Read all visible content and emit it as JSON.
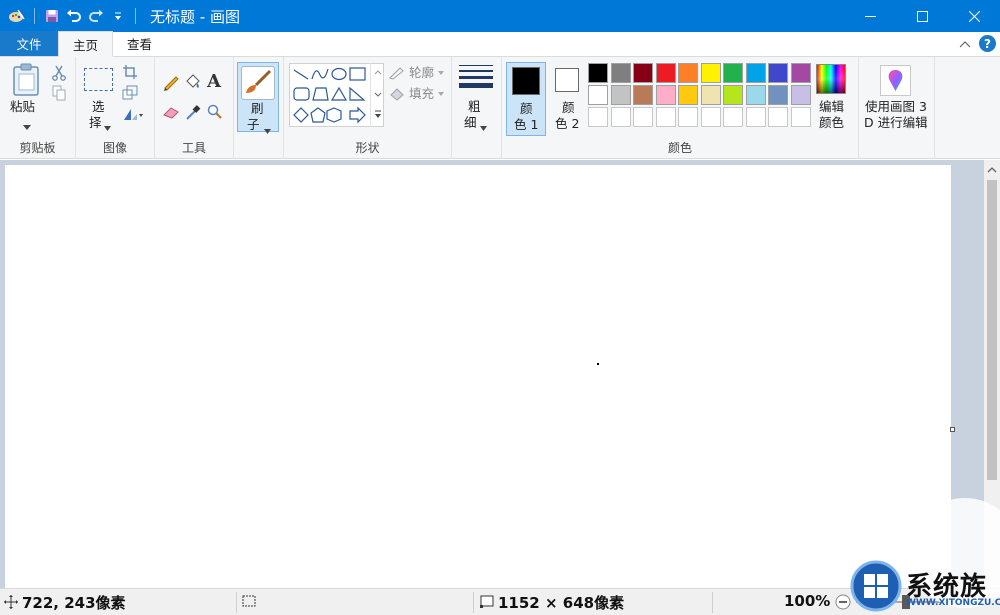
{
  "window": {
    "title": "无标题 - 画图"
  },
  "tabs": [
    {
      "label": "文件"
    },
    {
      "label": "主页"
    },
    {
      "label": "查看"
    }
  ],
  "ribbon": {
    "clipboard": {
      "paste_label": "粘贴",
      "group_label": "剪贴板"
    },
    "image": {
      "select_label_1": "选",
      "select_label_2": "择",
      "group_label": "图像"
    },
    "tools": {
      "group_label": "工具",
      "text_tool_glyph": "A"
    },
    "brushes": {
      "label_1": "刷",
      "label_2": "子"
    },
    "shapes": {
      "outline_label": "轮廓",
      "fill_label": "填充",
      "group_label": "形状"
    },
    "size": {
      "label_1": "粗",
      "label_2": "细"
    },
    "colors": {
      "color1_label_1": "颜",
      "color1_label_2": "色 1",
      "color2_label_1": "颜",
      "color2_label_2": "色 2",
      "edit_label_1": "编辑",
      "edit_label_2": "颜色",
      "group_label": "颜色",
      "color1": "#000000",
      "color2": "#ffffff",
      "palette_row1": [
        "#000000",
        "#7f7f7f",
        "#880015",
        "#ed1c24",
        "#ff7f27",
        "#fff200",
        "#22b14c",
        "#00a2e8",
        "#3f48cc",
        "#a349a4"
      ],
      "palette_row2": [
        "#ffffff",
        "#c3c3c3",
        "#b97a57",
        "#ffaec9",
        "#ffc90e",
        "#efe4b0",
        "#b5e61d",
        "#99d9ea",
        "#7092be",
        "#c8bfe7"
      ]
    },
    "paint3d": {
      "label_1": "使用画图 3",
      "label_2": "D 进行编辑"
    }
  },
  "status": {
    "cursor_position": "722, 243像素",
    "canvas_size": "1152 × 648像素",
    "zoom": "100%"
  },
  "watermark": {
    "text": "系统族",
    "url": "WWW.XITONGZU.COM"
  }
}
